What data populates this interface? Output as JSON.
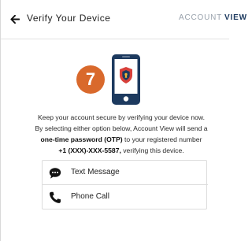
{
  "header": {
    "title": "Verify Your Device",
    "brand_light": "ACCOUNT",
    "brand_bold": "VIEW"
  },
  "step": {
    "number": "7"
  },
  "description": {
    "line1": "Keep your account secure by verifying your device now.",
    "line2": "By selecting either option below, Account View will send a",
    "otp_bold": "one-time password (OTP)",
    "line3_rest": " to your registered number",
    "phone_bold": "+1 (XXX)-XXX-5587,",
    "line4_rest": " verifying this device."
  },
  "options": [
    {
      "label": "Text Message",
      "icon": "chat-bubble-icon"
    },
    {
      "label": "Phone Call",
      "icon": "phone-icon"
    }
  ],
  "colors": {
    "accent_orange": "#d9692c",
    "navy": "#1d3a5f",
    "shield_red": "#d8403a",
    "shield_yellow": "#f2b233"
  }
}
